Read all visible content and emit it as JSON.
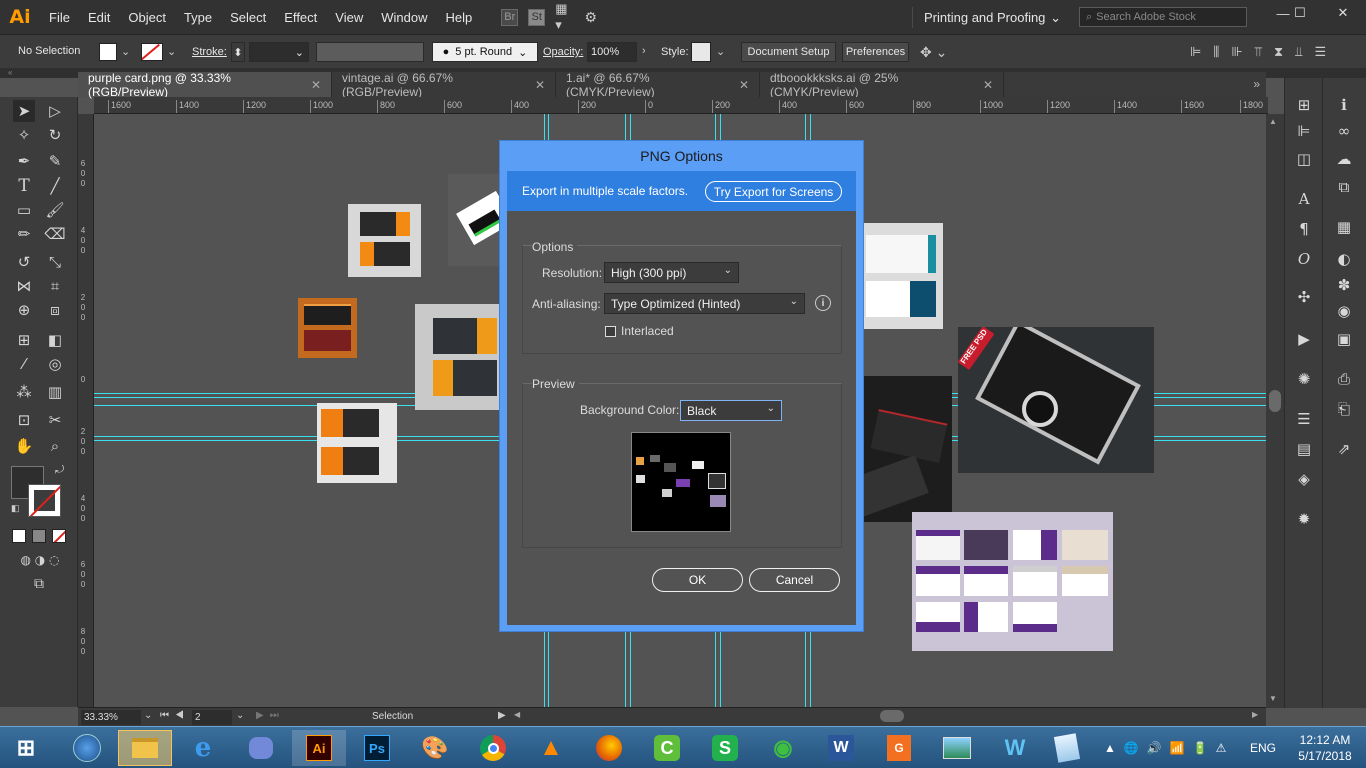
{
  "app": {
    "logo": "Ai",
    "menus": [
      "File",
      "Edit",
      "Object",
      "Type",
      "Select",
      "Effect",
      "View",
      "Window",
      "Help"
    ],
    "bridge": "Br",
    "stock_label": "St",
    "workspace": "Printing and Proofing",
    "search_placeholder": "Search Adobe Stock",
    "win_min": "—",
    "win_max": "☐",
    "win_close": "✕"
  },
  "control": {
    "selection": "No Selection",
    "stroke_label": "Stroke:",
    "brush": "5 pt. Round",
    "opacity_label": "Opacity:",
    "opacity": "100%",
    "style_label": "Style:",
    "doc_setup": "Document Setup",
    "preferences": "Preferences"
  },
  "tabs": [
    {
      "label": "purple card.png @ 33.33% (RGB/Preview)",
      "close": "✕"
    },
    {
      "label": "vintage.ai @ 66.67% (RGB/Preview)",
      "close": "✕"
    },
    {
      "label": "1.ai* @ 66.67% (CMYK/Preview)",
      "close": "✕"
    },
    {
      "label": "dtboookkksks.ai @ 25% (CMYK/Preview)",
      "close": "✕"
    }
  ],
  "ruler": [
    "1600",
    "1400",
    "1200",
    "1000",
    "800",
    "600",
    "400",
    "200",
    "0",
    "200",
    "400",
    "600",
    "800",
    "1000",
    "1200",
    "1400",
    "1600",
    "1800"
  ],
  "vruler": [
    "6",
    "0",
    "0",
    "4",
    "0",
    "0",
    "2",
    "0",
    "0",
    "0",
    "2",
    "0",
    "0",
    "4",
    "0",
    "0",
    "6",
    "0",
    "0",
    "8",
    "0",
    "0"
  ],
  "status": {
    "zoom": "33.33%",
    "artboard": "2",
    "mode": "Selection"
  },
  "dialog": {
    "title": "PNG Options",
    "banner": "Export in multiple scale factors.",
    "try_button": "Try Export for Screens",
    "options_title": "Options",
    "resolution_label": "Resolution:",
    "resolution": "High (300 ppi)",
    "antialias_label": "Anti-aliasing:",
    "antialias": "Type Optimized (Hinted)",
    "info": "i",
    "interlaced": "Interlaced",
    "preview_title": "Preview",
    "bg_label": "Background Color:",
    "bg": "Black",
    "ok": "OK",
    "cancel": "Cancel"
  },
  "artwork": {
    "free_psd": "FREE PSD"
  },
  "taskbar": {
    "time": "12:12 AM",
    "date": "5/17/2018",
    "lang": "ENG"
  }
}
